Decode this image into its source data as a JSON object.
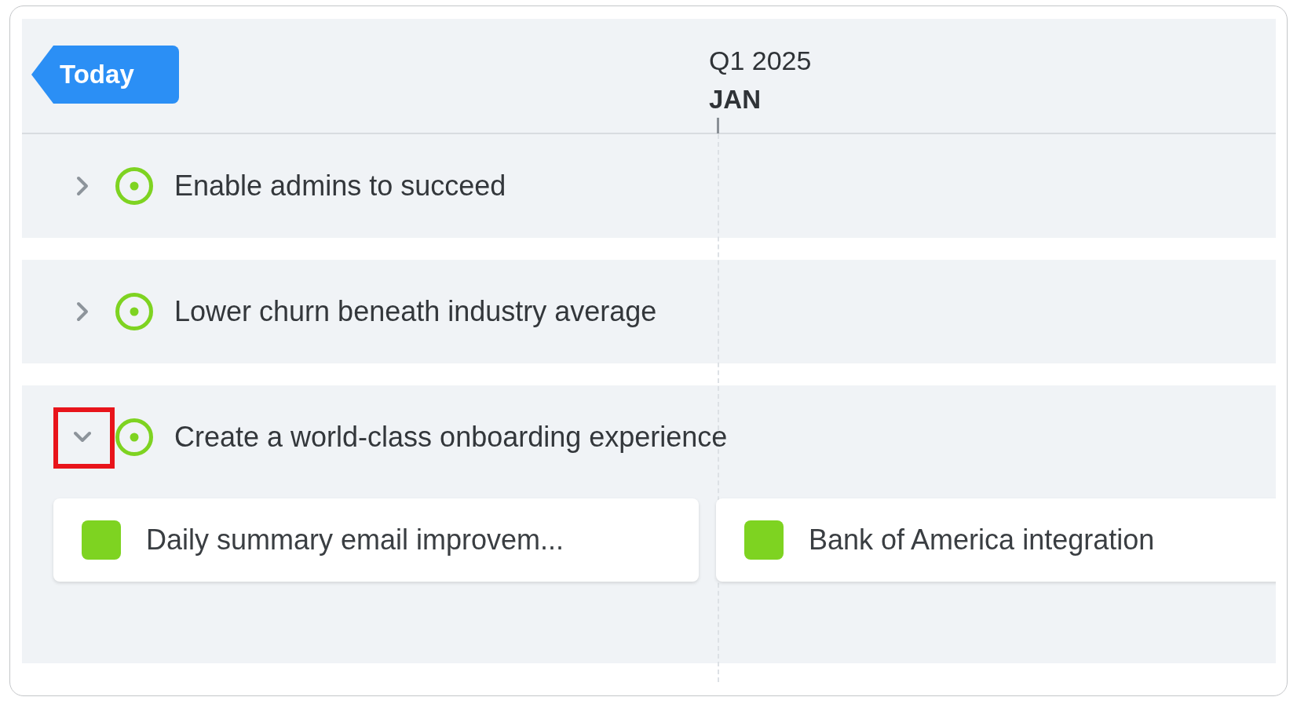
{
  "today_button": {
    "label": "Today"
  },
  "timeline_header": {
    "quarter": "Q1 2025",
    "month": "JAN"
  },
  "rows": [
    {
      "title": "Enable admins to succeed",
      "expanded": false,
      "highlighted": false,
      "items": []
    },
    {
      "title": "Lower churn beneath industry average",
      "expanded": false,
      "highlighted": false,
      "items": []
    },
    {
      "title": "Create a world-class onboarding experience",
      "expanded": true,
      "highlighted": true,
      "items": [
        {
          "title": "Daily summary email improvem..."
        },
        {
          "title": "Bank of America integration"
        }
      ]
    }
  ]
}
